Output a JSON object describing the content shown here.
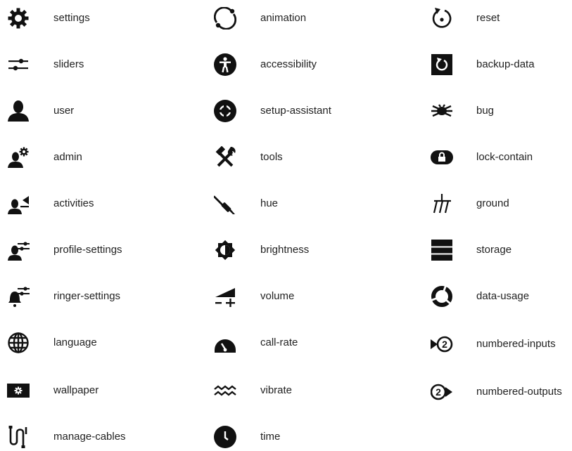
{
  "icons": [
    {
      "label": "settings",
      "icon": "settings-icon"
    },
    {
      "label": "sliders",
      "icon": "sliders-icon"
    },
    {
      "label": "user",
      "icon": "user-icon"
    },
    {
      "label": "admin",
      "icon": "admin-icon"
    },
    {
      "label": "activities",
      "icon": "activities-icon"
    },
    {
      "label": "profile-settings",
      "icon": "profile-settings-icon"
    },
    {
      "label": "ringer-settings",
      "icon": "ringer-settings-icon"
    },
    {
      "label": "language",
      "icon": "language-icon"
    },
    {
      "label": "wallpaper",
      "icon": "wallpaper-icon"
    },
    {
      "label": "manage-cables",
      "icon": "manage-cables-icon"
    },
    {
      "label": "animation",
      "icon": "animation-icon"
    },
    {
      "label": "accessibility",
      "icon": "accessibility-icon"
    },
    {
      "label": "setup-assistant",
      "icon": "setup-assistant-icon"
    },
    {
      "label": "tools",
      "icon": "tools-icon"
    },
    {
      "label": "hue",
      "icon": "hue-icon"
    },
    {
      "label": "brightness",
      "icon": "brightness-icon"
    },
    {
      "label": "volume",
      "icon": "volume-icon"
    },
    {
      "label": "call-rate",
      "icon": "call-rate-icon"
    },
    {
      "label": "vibrate",
      "icon": "vibrate-icon"
    },
    {
      "label": "time",
      "icon": "time-icon"
    },
    {
      "label": "reset",
      "icon": "reset-icon"
    },
    {
      "label": "backup-data",
      "icon": "backup-data-icon"
    },
    {
      "label": "bug",
      "icon": "bug-icon"
    },
    {
      "label": "lock-contain",
      "icon": "lock-contain-icon"
    },
    {
      "label": "ground",
      "icon": "ground-icon"
    },
    {
      "label": "storage",
      "icon": "storage-icon"
    },
    {
      "label": "data-usage",
      "icon": "data-usage-icon"
    },
    {
      "label": "numbered-inputs",
      "icon": "numbered-inputs-icon"
    },
    {
      "label": "numbered-outputs",
      "icon": "numbered-outputs-icon"
    }
  ],
  "colors": {
    "icon": "#111111",
    "text": "#222222",
    "background": "#ffffff"
  }
}
